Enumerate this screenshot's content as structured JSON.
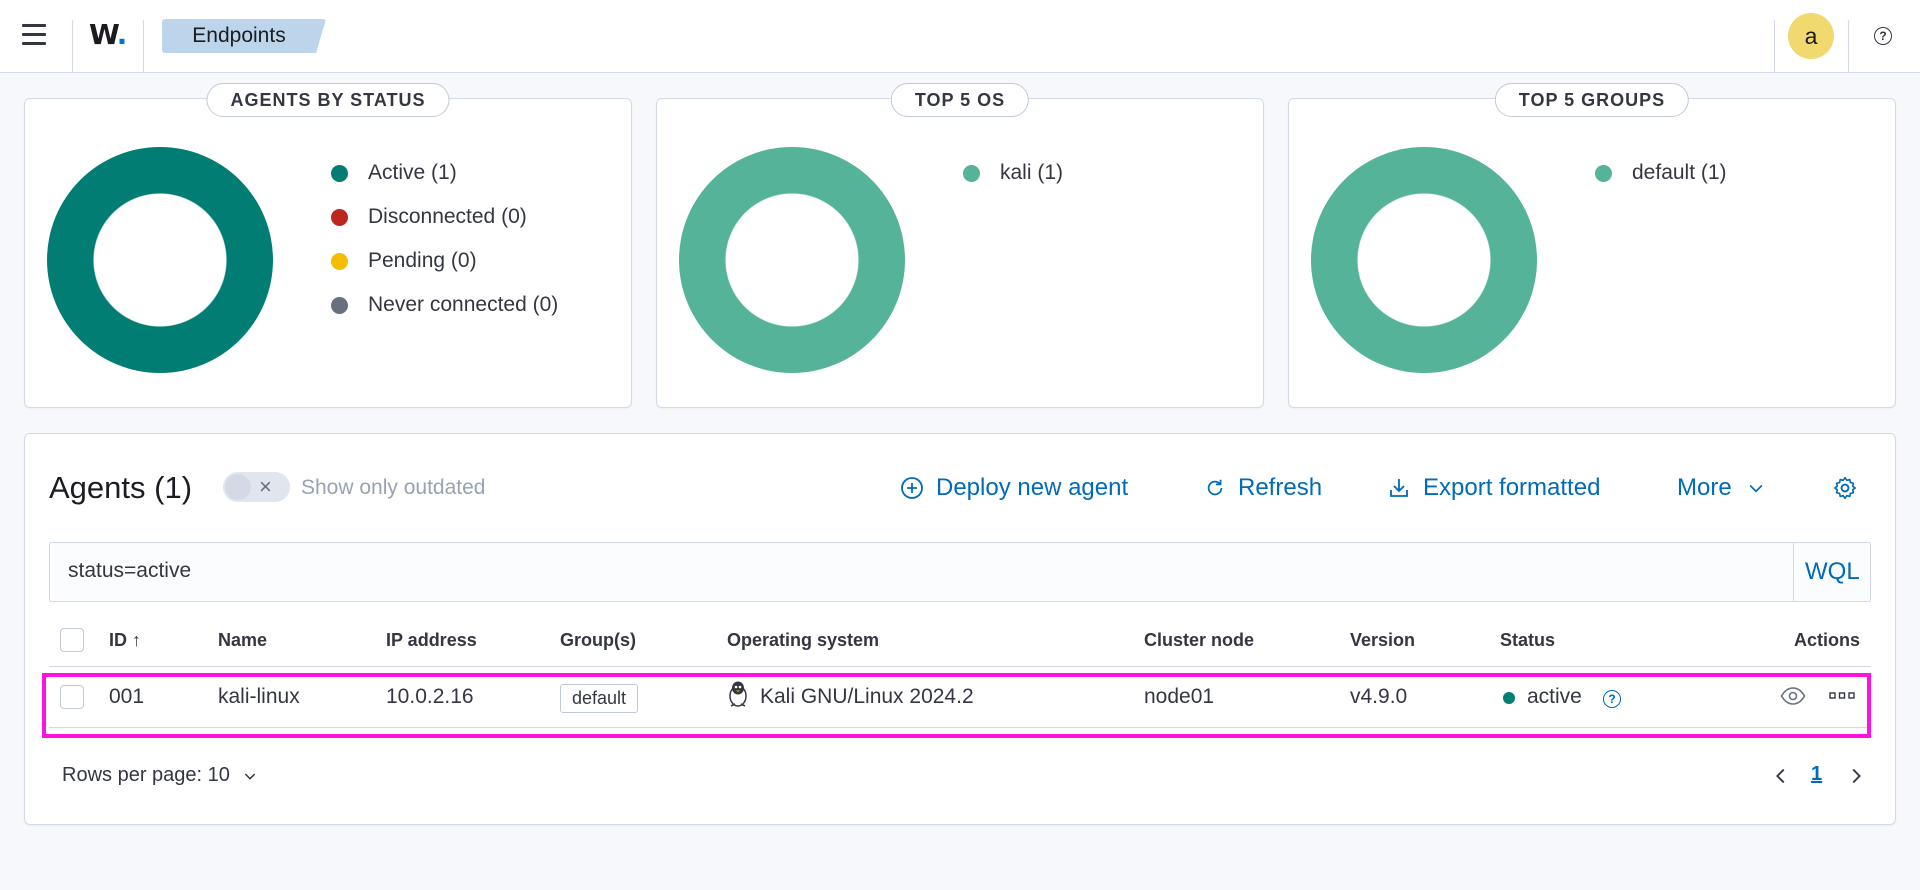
{
  "header": {
    "logo_text": "W",
    "logo_dot": ".",
    "breadcrumb": "Endpoints",
    "avatar_initial": "a",
    "help_glyph": "?"
  },
  "colors": {
    "active": "#017d73",
    "disconnected": "#bd271e",
    "pending": "#f5bd00",
    "never_connected": "#69707d",
    "group_series": "#54b399",
    "link": "#006bb8",
    "highlight": "#ff11e3"
  },
  "cards": [
    {
      "title": "AGENTS BY STATUS",
      "legend": [
        {
          "label": "Active (1)",
          "color": "#017d73"
        },
        {
          "label": "Disconnected (0)",
          "color": "#bd271e"
        },
        {
          "label": "Pending (0)",
          "color": "#f5bd00"
        },
        {
          "label": "Never connected (0)",
          "color": "#69707d"
        }
      ]
    },
    {
      "title": "TOP 5 OS",
      "legend": [
        {
          "label": "kali (1)",
          "color": "#54b399"
        }
      ]
    },
    {
      "title": "TOP 5 GROUPS",
      "legend": [
        {
          "label": "default (1)",
          "color": "#54b399"
        }
      ]
    }
  ],
  "agents": {
    "title": "Agents (1)",
    "toggle_label": "Show only outdated",
    "toggle_on": false,
    "actions": {
      "deploy": "Deploy new agent",
      "refresh": "Refresh",
      "export": "Export formatted",
      "more": "More"
    },
    "search_value": "status=active",
    "search_mode": "WQL",
    "columns": [
      "ID",
      "Name",
      "IP address",
      "Group(s)",
      "Operating system",
      "Cluster node",
      "Version",
      "Status",
      "Actions"
    ],
    "sort_indicator": "↑",
    "rows": [
      {
        "id": "001",
        "name": "kali-linux",
        "ip": "10.0.2.16",
        "group": "default",
        "os": "Kali GNU/Linux 2024.2",
        "cluster_node": "node01",
        "version": "v4.9.0",
        "status": "active"
      }
    ],
    "pagination": {
      "rows_per_page": "Rows per page: 10",
      "current_page": "1"
    }
  }
}
